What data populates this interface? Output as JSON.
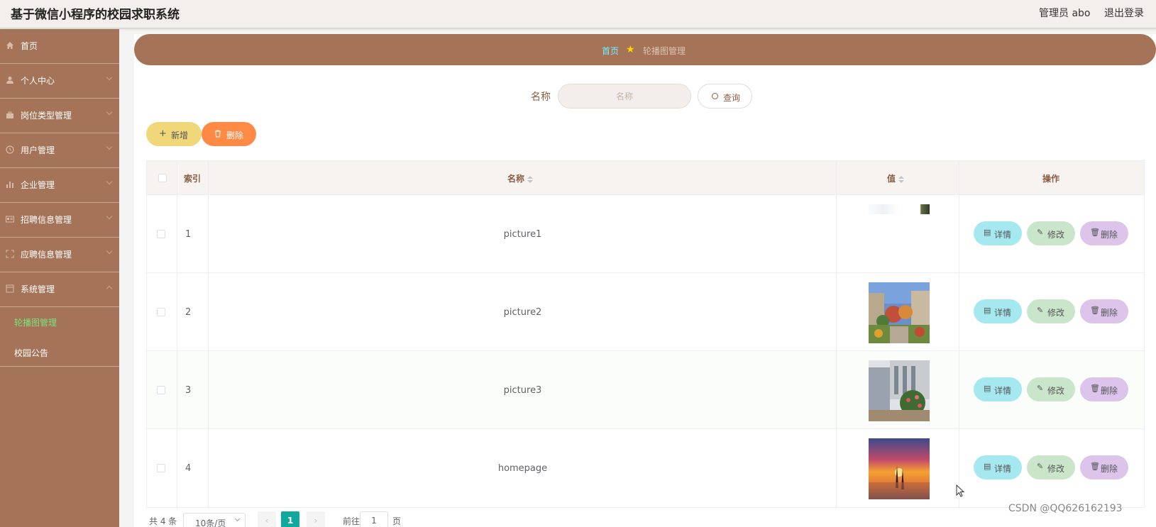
{
  "header": {
    "title": "基于微信小程序的校园求职系统",
    "admin": "管理员 abo",
    "logout": "退出登录"
  },
  "sidebar": {
    "items": [
      {
        "label": "首页",
        "icon": "home-icon"
      },
      {
        "label": "个人中心",
        "icon": "user-icon"
      },
      {
        "label": "岗位类型管理",
        "icon": "briefcase-icon"
      },
      {
        "label": "用户管理",
        "icon": "clock-icon"
      },
      {
        "label": "企业管理",
        "icon": "bar-chart-icon"
      },
      {
        "label": "招聘信息管理",
        "icon": "id-card-icon"
      },
      {
        "label": "应聘信息管理",
        "icon": "scan-icon"
      },
      {
        "label": "系统管理",
        "icon": "window-icon"
      }
    ],
    "sub_items": [
      {
        "label": "轮播图管理",
        "active": true
      },
      {
        "label": "校园公告",
        "active": false
      }
    ]
  },
  "breadcrumb": {
    "home": "首页",
    "current": "轮播图管理"
  },
  "search": {
    "label": "名称",
    "placeholder": "名称",
    "button": "查询"
  },
  "toolbar": {
    "add": "新增",
    "delete": "删除"
  },
  "table": {
    "headers": {
      "index": "索引",
      "name": "名称",
      "value": "值",
      "actions": "操作"
    },
    "rows": [
      {
        "index": "1",
        "name": "picture1"
      },
      {
        "index": "2",
        "name": "picture2"
      },
      {
        "index": "3",
        "name": "picture3"
      },
      {
        "index": "4",
        "name": "homepage"
      }
    ],
    "row_actions": {
      "detail": "详情",
      "edit": "修改",
      "delete": "删除"
    }
  },
  "pagination": {
    "total": "共 4 条",
    "page_size": "10条/页",
    "current_page": "1",
    "goto": "前往",
    "goto_value": "1",
    "page_unit": "页"
  },
  "watermark": "CSDN @QQ626162193",
  "colors": {
    "sidebar": "#a57458",
    "breadcrumb_home": "#6ef2ff",
    "active_sub_item": "#7ee07e",
    "page_active": "#13a89e"
  }
}
